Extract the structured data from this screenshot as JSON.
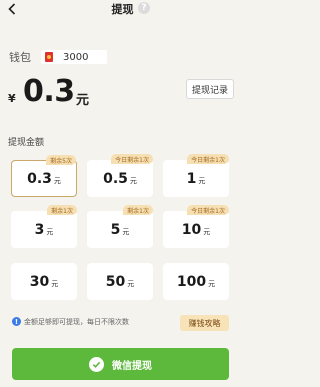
{
  "header": {
    "title": "提现",
    "help_glyph": "?"
  },
  "wallet": {
    "label": "钱包",
    "value": "3000",
    "currency_symbol": "¥",
    "balance": "0.3",
    "balance_unit": "元",
    "records_label": "提现记录"
  },
  "amount_section_label": "提现金额",
  "amounts": [
    {
      "value": "0.3",
      "unit": "元",
      "tag": "剩余5次",
      "selected": true
    },
    {
      "value": "0.5",
      "unit": "元",
      "tag": "今日剩余1次",
      "selected": false
    },
    {
      "value": "1",
      "unit": "元",
      "tag": "今日剩余1次",
      "selected": false
    },
    {
      "value": "3",
      "unit": "元",
      "tag": "剩余1次",
      "selected": false
    },
    {
      "value": "5",
      "unit": "元",
      "tag": "剩余1次",
      "selected": false
    },
    {
      "value": "10",
      "unit": "元",
      "tag": "今日剩余1次",
      "selected": false
    },
    {
      "value": "30",
      "unit": "元",
      "tag": "",
      "selected": false
    },
    {
      "value": "50",
      "unit": "元",
      "tag": "",
      "selected": false
    },
    {
      "value": "100",
      "unit": "元",
      "tag": "",
      "selected": false
    }
  ],
  "notice": {
    "glyph": "!",
    "text": "金额足够即可提现，每日不限次数"
  },
  "strategy_label": "赚钱攻略",
  "withdraw_label": "微信提现",
  "colors": {
    "accent": "#5cb93b",
    "tag_bg": "#f6dfb3",
    "selected_border": "#c9a86a"
  }
}
